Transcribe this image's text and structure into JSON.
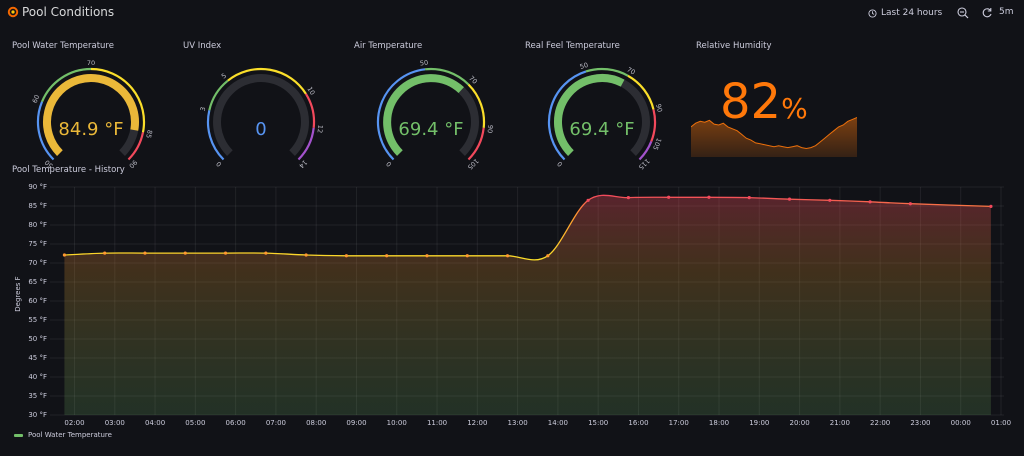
{
  "header": {
    "title": "Pool Conditions",
    "time_range": "Last 24 hours",
    "refresh_interval": "5m"
  },
  "colors": {
    "background": "#111217",
    "green": "#73bf69",
    "yellow": "#fade2a",
    "orange": "#ff780a",
    "gold": "#eab839",
    "red": "#f2495c",
    "purple": "#a352cc",
    "blue": "#5794f2",
    "track": "#2c2d33"
  },
  "gauges": [
    {
      "title": "Pool Water Temperature",
      "value_text": "84.9 °F",
      "value": 84.9,
      "min": 50,
      "max": 90,
      "value_color": "#eab839",
      "thresholds": [
        {
          "from": 50,
          "to": 60,
          "color": "#5794f2"
        },
        {
          "from": 60,
          "to": 70,
          "color": "#73bf69"
        },
        {
          "from": 70,
          "to": 85,
          "color": "#fade2a"
        },
        {
          "from": 85,
          "to": 90,
          "color": "#f2495c"
        }
      ],
      "ticks": [
        "50",
        "60",
        "70",
        "85",
        "90"
      ]
    },
    {
      "title": "UV Index",
      "value_text": "0",
      "value": 0,
      "min": 0,
      "max": 14,
      "value_color": "#5794f2",
      "thresholds": [
        {
          "from": 0,
          "to": 3,
          "color": "#5794f2"
        },
        {
          "from": 3,
          "to": 5,
          "color": "#73bf69"
        },
        {
          "from": 5,
          "to": 10,
          "color": "#fade2a"
        },
        {
          "from": 10,
          "to": 12,
          "color": "#f2495c"
        },
        {
          "from": 12,
          "to": 14,
          "color": "#a352cc"
        }
      ],
      "ticks": [
        "0",
        "3",
        "5",
        "10",
        "12",
        "14"
      ]
    },
    {
      "title": "Air Temperature",
      "value_text": "69.4 °F",
      "value": 69.4,
      "min": 0,
      "max": 105,
      "value_color": "#73bf69",
      "thresholds": [
        {
          "from": 0,
          "to": 50,
          "color": "#5794f2"
        },
        {
          "from": 50,
          "to": 70,
          "color": "#73bf69"
        },
        {
          "from": 70,
          "to": 90,
          "color": "#fade2a"
        },
        {
          "from": 90,
          "to": 105,
          "color": "#f2495c"
        }
      ],
      "ticks": [
        "0",
        "50",
        "70",
        "90",
        "105"
      ]
    },
    {
      "title": "Real Feel Temperature",
      "value_text": "69.4 °F",
      "value": 69.4,
      "min": 0,
      "max": 115,
      "value_color": "#73bf69",
      "thresholds": [
        {
          "from": 0,
          "to": 50,
          "color": "#5794f2"
        },
        {
          "from": 50,
          "to": 70,
          "color": "#73bf69"
        },
        {
          "from": 70,
          "to": 90,
          "color": "#fade2a"
        },
        {
          "from": 90,
          "to": 105,
          "color": "#f2495c"
        },
        {
          "from": 105,
          "to": 115,
          "color": "#a352cc"
        }
      ],
      "ticks": [
        "0",
        "50",
        "70",
        "90",
        "105",
        "115"
      ]
    }
  ],
  "humidity": {
    "title": "Relative Humidity",
    "value": "82",
    "unit": "%",
    "sparkline": [
      72,
      76,
      78,
      77,
      79,
      75,
      74,
      76,
      72,
      70,
      68,
      64,
      60,
      58,
      55,
      54,
      53,
      52,
      51,
      52,
      51,
      50,
      51,
      52,
      50,
      49,
      50,
      52,
      56,
      60,
      64,
      68,
      72,
      74,
      78,
      80,
      82
    ]
  },
  "history": {
    "title": "Pool Temperature - History",
    "ylabel": "Degrees F",
    "legend": "Pool Water Temperature",
    "y_ticks": [
      "90 °F",
      "85 °F",
      "80 °F",
      "75 °F",
      "70 °F",
      "65 °F",
      "60 °F",
      "55 °F",
      "50 °F",
      "45 °F",
      "40 °F",
      "35 °F",
      "30 °F"
    ],
    "x_ticks": [
      "02:00",
      "03:00",
      "04:00",
      "05:00",
      "06:00",
      "07:00",
      "08:00",
      "09:00",
      "10:00",
      "11:00",
      "12:00",
      "13:00",
      "14:00",
      "15:00",
      "16:00",
      "17:00",
      "18:00",
      "19:00",
      "20:00",
      "21:00",
      "22:00",
      "23:00",
      "00:00",
      "01:00"
    ]
  },
  "chart_data": {
    "type": "line",
    "title": "Pool Temperature - History",
    "ylabel": "Degrees F",
    "ylim": [
      30,
      90
    ],
    "grid": true,
    "legend_placement": "bottom-left",
    "x": [
      "01:45",
      "02:45",
      "03:45",
      "04:45",
      "05:45",
      "06:45",
      "07:45",
      "08:45",
      "09:45",
      "10:45",
      "11:45",
      "12:45",
      "13:45",
      "14:45",
      "15:45",
      "16:45",
      "17:45",
      "18:45",
      "19:45",
      "20:45",
      "21:45",
      "22:45",
      "00:45"
    ],
    "series": [
      {
        "name": "Pool Water Temperature",
        "values": [
          72.1,
          72.6,
          72.6,
          72.6,
          72.6,
          72.6,
          72.1,
          71.9,
          71.9,
          71.9,
          71.9,
          71.9,
          71.9,
          86.5,
          87.2,
          87.3,
          87.3,
          87.2,
          86.8,
          86.5,
          86.1,
          85.6,
          84.9
        ]
      }
    ]
  }
}
